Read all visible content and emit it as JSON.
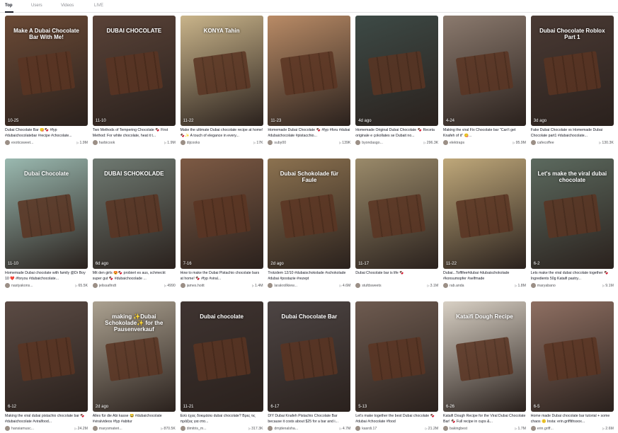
{
  "tabs": [
    {
      "label": "Top",
      "active": true
    },
    {
      "label": "Users",
      "active": false
    },
    {
      "label": "Videos",
      "active": false
    },
    {
      "label": "LIVE",
      "active": false
    }
  ],
  "videos": [
    {
      "date": "10-25",
      "overlay": "Make A Dubai Chocolate Bar With Me!",
      "caption": "Dubai Chocolate Bar 😋🍫 #fyp #dubaichocolatebar #recipe #chocolate...",
      "user": "exoticsweet...",
      "views": "1.9M",
      "bg": "#6b4a36"
    },
    {
      "date": "11-10",
      "overlay": "DUBAI CHOCOLATE",
      "caption": "Two Methods of Tempering Chocolate 🍫 First Method: For white chocolate, heat it t...",
      "user": "harbicook",
      "views": "1.9M",
      "bg": "#5a4338"
    },
    {
      "date": "11-22",
      "overlay": "KONYA Tahin",
      "caption": "Make the ultimate Dubai chocolate recipe at home! 🍫✨ A touch of elegance in every...",
      "user": "dijcooks",
      "views": "17K",
      "bg": "#c9b48a"
    },
    {
      "date": "11-23",
      "overlay": "",
      "caption": "Homemade Dubai Chocolate 🍫 #fyp #foru #dubai #dubaichocolate #pistacchio...",
      "user": "suby00",
      "views": "139K",
      "bg": "#b98b66"
    },
    {
      "date": "4d ago",
      "overlay": "",
      "caption": "Homemade Original Dubai Chocolate 🍫 Receta originale e çokollates se Dubait no...",
      "user": "byondasgo...",
      "views": "296.3K",
      "bg": "#3d4a46"
    },
    {
      "date": "4-24",
      "overlay": "",
      "caption": "Making the viral Fix Chocolate bar \"Can't get Knafeh of it\" 😋...",
      "user": "elektraps",
      "views": "95.9M",
      "bg": "#8b7a6e"
    },
    {
      "date": "3d ago",
      "overlay": "Dubai Chocolate Roblox Part 1",
      "caption": "Fake Dubai Chocolate vs Homemade Dubai Chocolate part1 #dubaichocolate...",
      "user": "cafecoffee",
      "views": "130.3K",
      "bg": "#4a3a34"
    },
    {
      "date": "11-10",
      "overlay": "Dubai Chocolate",
      "caption": "Homemade Dubai chocolate with family @Dr Boy 10 ❤️ #foryou #dubaichocolate...",
      "user": "nastyakons...",
      "views": "65.5K",
      "bg": "#9ab9b0"
    },
    {
      "date": "6d ago",
      "overlay": "DUBAI SCHOKOLADE",
      "caption": "Mit den girls 😍🍫 probiert es aus, schmeckt super gut 🍫 #dubaichocolade ...",
      "user": "jelissafindt",
      "views": "4990",
      "bg": "#6f7a72"
    },
    {
      "date": "7-16",
      "overlay": "",
      "caption": "How to make the Dubai Pistachio chocolate bars at home! 🍫 #fyp #viral...",
      "user": "james.hoitt",
      "views": "1.4M",
      "bg": "#7d5a44"
    },
    {
      "date": "2d ago",
      "overlay": "Dubai Schokolade für Faule",
      "caption": "Trotzdem 12/10 #dubaischokolade #schokolade #dubai #postazie #rezept",
      "user": "larakrollkiew...",
      "views": "4.6M",
      "bg": "#8c7250"
    },
    {
      "date": "11-17",
      "overlay": "",
      "caption": "Dubai Chocolate bar is life 🍫",
      "user": "stufdsweets",
      "views": "3.1M",
      "bg": "#9a8a6a"
    },
    {
      "date": "11-22",
      "overlay": "",
      "caption": "Dubai...Toffifee#dubai #dubaischokolade #konsumopfer #selfmade",
      "user": "rab.anda",
      "views": "1.8M",
      "bg": "#bfa87a"
    },
    {
      "date": "6-2",
      "overlay": "Let's make the viral dubai chocolate",
      "caption": "Lets make the viral dubai chocolate together 🍫 Ingredients 50g Kataifi pastry...",
      "user": "maryabano",
      "views": "9.1M",
      "bg": "#5c6a5f"
    },
    {
      "date": "6-12",
      "overlay": "",
      "caption": "Making the viral dubai pistachio chocolate bar 🍫 #dubaichocolate #viralfood...",
      "user": "hansiamusc...",
      "views": "24.2M",
      "bg": "#5b4b44"
    },
    {
      "date": "2d ago",
      "overlay": "making ✨Dubai Schokolade✨ for the Pausenverkauf",
      "caption": "Alles für die Abi kasse 😂 #dubaichocolate #viralvideos #fyp #abitur",
      "user": "marysmateri...",
      "views": "870.5K",
      "bg": "#aba190"
    },
    {
      "date": "11-21",
      "overlay": "Dubai chocolate",
      "caption": "Εσύ έχεις δοκιμάσει dubai chocolate? Βρες τις πράξεις για στο...",
      "user": "dimitris_m...",
      "views": "317.3K",
      "bg": "#3f3431"
    },
    {
      "date": "6-17",
      "overlay": "Dubai Chocolate Bar",
      "caption": "DIY Dubai Knafeh Pistachio Chocolate Bar because it costs about $25 for a bar and i...",
      "user": "dmjdenalsha...",
      "views": "4.7M",
      "bg": "#4d4544"
    },
    {
      "date": "5-13",
      "overlay": "",
      "caption": "Let's make together the best Dubai chocolate 🍫 #dubai #chocolate #food",
      "user": "kasrdi.17",
      "views": "21.2M",
      "bg": "#6e5b50"
    },
    {
      "date": "6-26",
      "overlay": "Kataifi Dough Recipe",
      "caption": "Kataifi Dough Recipe for the Viral Dubai Chocolate Bar! 🍫 Full recipe in cups &...",
      "user": "bakingbest",
      "views": "1.7M",
      "bg": "#d8d0c4"
    },
    {
      "date": "6-5",
      "overlay": "",
      "caption": "Home made Dubai chocolate bar tutorial + some chaos 🙃 Insta: erin.griffithsxox...",
      "user": "erin.griff...",
      "views": "2.6M",
      "bg": "#8e6f62"
    }
  ]
}
